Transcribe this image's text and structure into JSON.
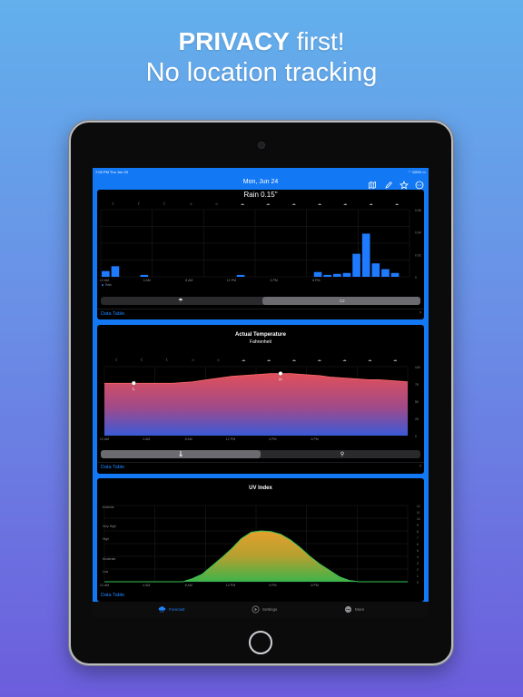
{
  "headline": {
    "line1_bold": "PRIVACY",
    "line1_rest": " first!",
    "line2": "No location tracking"
  },
  "status": {
    "time": "7:09 PM   Thu Jun 20",
    "battery": "100%"
  },
  "nav": {
    "title": "Mon, Jun 24",
    "icons": [
      "map-icon",
      "pencil-icon",
      "star-icon",
      "more-circle-icon"
    ]
  },
  "rain_card": {
    "title": "Rain",
    "value": "0.15\"",
    "legend": "Rain",
    "data_table_label": "Data Table",
    "chevron": "›"
  },
  "temp_card": {
    "title": "Actual Temperature",
    "subtitle": "Fahrenheit",
    "low_marker": "L",
    "high_marker": "H",
    "data_table_label": "Data Table",
    "chevron": "›"
  },
  "uv_card": {
    "title": "UV Index",
    "data_table_label": "Data Table"
  },
  "tabs": [
    {
      "label": "Forecast",
      "icon": "cloud-rain-icon",
      "active": true
    },
    {
      "label": "Settings",
      "icon": "play-circle-icon",
      "active": false
    },
    {
      "label": "More",
      "icon": "more-circle-icon",
      "active": false
    }
  ],
  "colors": {
    "accent": "#1378f4",
    "bar": "#1e7bff",
    "uv_line": "#34c759"
  },
  "chart_data": [
    {
      "type": "bar",
      "title": "Rain",
      "x_ticks": [
        "12 AM",
        "4 AM",
        "8 AM",
        "12 PM",
        "4 PM",
        "8 PM"
      ],
      "y_ticks": [
        "0.06",
        "0.04",
        "0.02",
        "0"
      ],
      "ylim": [
        0,
        0.07
      ],
      "series": [
        {
          "name": "Rain",
          "values": [
            0.006,
            0.011,
            0,
            0,
            0.002,
            0,
            0,
            0,
            0,
            0,
            0,
            0,
            0,
            0,
            0.002,
            0,
            0,
            0,
            0,
            0,
            0,
            0,
            0.005,
            0.002,
            0.003,
            0.004,
            0.024,
            0.045,
            0.014,
            0.008,
            0.004,
            0
          ]
        }
      ],
      "grid": true
    },
    {
      "type": "area",
      "title": "Actual Temperature",
      "subtitle": "Fahrenheit",
      "x_ticks": [
        "12 AM",
        "4 AM",
        "8 AM",
        "12 PM",
        "4 PM",
        "8 PM"
      ],
      "y_ticks": [
        "100",
        "75",
        "50",
        "25",
        "0"
      ],
      "ylim": [
        0,
        100
      ],
      "series": [
        {
          "values": [
            76,
            76,
            76,
            76,
            76,
            76,
            76,
            76,
            77,
            78,
            80,
            82,
            84,
            86,
            87,
            88,
            89,
            90,
            90,
            90,
            89,
            88,
            87,
            85,
            84,
            83,
            82,
            81,
            81,
            80,
            79,
            78
          ]
        }
      ],
      "grid": true
    },
    {
      "type": "area",
      "title": "UV Index",
      "x_ticks": [
        "12 AM",
        "4 AM",
        "8 AM",
        "12 PM",
        "4 PM",
        "8 PM"
      ],
      "y_ticks": [
        "12",
        "11",
        "10",
        "9",
        "8",
        "7",
        "6",
        "5",
        "4",
        "3",
        "2",
        "1",
        "0"
      ],
      "category_labels": [
        "Extreme",
        "Very High",
        "High",
        "Moderate",
        "Low"
      ],
      "ylim": [
        0,
        12
      ],
      "series": [
        {
          "values": [
            0,
            0,
            0,
            0,
            0,
            0,
            0,
            0,
            0,
            0.5,
            1.2,
            2.5,
            3.8,
            5.2,
            6.8,
            7.8,
            8.0,
            7.9,
            7.5,
            6.6,
            5.4,
            4.0,
            2.8,
            1.8,
            0.8,
            0.2,
            0,
            0,
            0,
            0,
            0,
            0
          ]
        }
      ],
      "grid": true
    }
  ]
}
